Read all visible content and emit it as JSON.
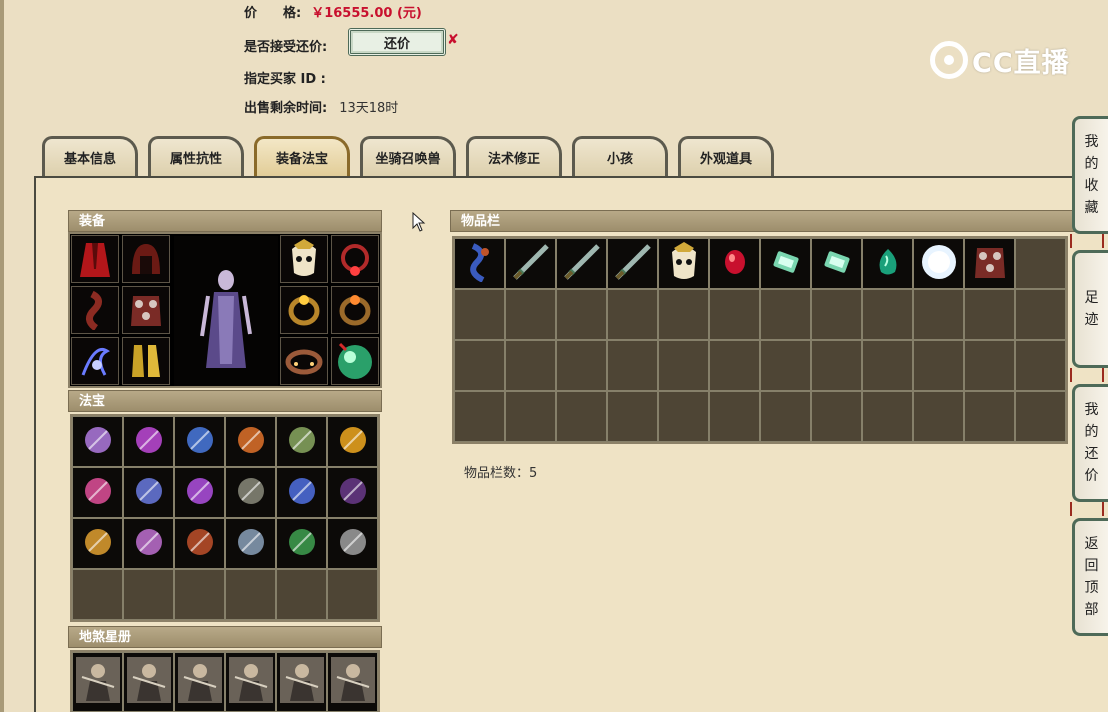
{
  "info": {
    "price_label": "价　　格:",
    "price_value": "￥16555.00 (元)",
    "counter_label": "是否接受还价:",
    "counter_button": "还价",
    "buyer_label": "指定买家 ID :",
    "time_label": "出售剩余时间:",
    "time_value": "13天18时"
  },
  "logo": {
    "text": "CC直播"
  },
  "tabs": [
    {
      "label": "基本信息",
      "active": false
    },
    {
      "label": "属性抗性",
      "active": false
    },
    {
      "label": "装备法宝",
      "active": true
    },
    {
      "label": "坐骑召唤兽",
      "active": false
    },
    {
      "label": "法术修正",
      "active": false
    },
    {
      "label": "小孩",
      "active": false
    },
    {
      "label": "外观道具",
      "active": false
    }
  ],
  "sections": {
    "equipment": "装备",
    "treasure": "法宝",
    "star_book": "地煞星册",
    "inventory": "物品栏"
  },
  "inventory": {
    "count_label": "物品栏数：5",
    "items": [
      "scroll-icon",
      "sword-icon",
      "sword-icon",
      "sword-icon",
      "mask-icon",
      "ruby-icon",
      "jade-tablet-icon",
      "jade-tablet-icon",
      "jade-stone-icon",
      "pearl-icon",
      "armor-icon"
    ]
  },
  "float_menu": {
    "favorites": [
      "我",
      "的",
      "收",
      "藏"
    ],
    "footprints": [
      "足",
      "迹"
    ],
    "my_offers": [
      "我",
      "的",
      "还",
      "价"
    ],
    "back_top": [
      "返",
      "回",
      "顶",
      "部"
    ]
  },
  "colors": {
    "price": "#c8102e",
    "background": "#ebdfc3",
    "section_header": "#a89a78",
    "empty_slot": "#4e4535"
  }
}
